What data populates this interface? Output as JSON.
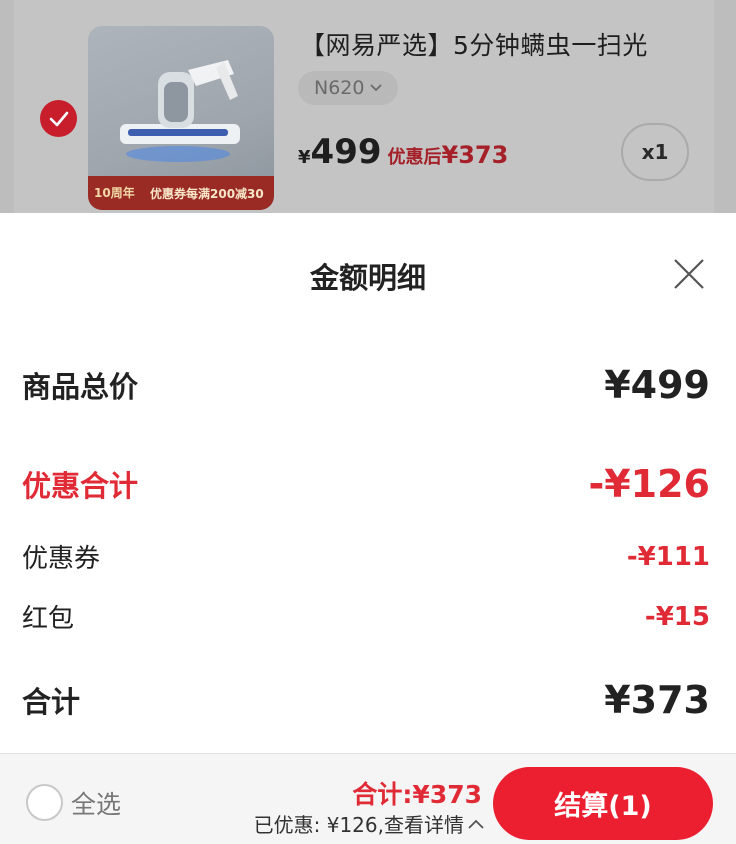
{
  "cart_item": {
    "title": "【网易严选】5分钟螨虫一扫光",
    "sku": "N620",
    "price_symbol": "¥",
    "price": "499",
    "after_discount_label": "优惠后",
    "after_discount_price": "¥373",
    "quantity": "x1",
    "promo_anniversary": "10周年",
    "promo_text": "优惠券每满200减30",
    "checked": true
  },
  "sheet": {
    "title": "金额明细",
    "rows": {
      "subtotal": {
        "label": "商品总价",
        "value": "¥499"
      },
      "discount_total": {
        "label": "优惠合计",
        "value": "-¥126"
      },
      "coupon": {
        "label": "优惠券",
        "value": "-¥111"
      },
      "red_packet": {
        "label": "红包",
        "value": "-¥15"
      },
      "total": {
        "label": "合计",
        "value": "¥373"
      }
    }
  },
  "bottom_bar": {
    "select_all_label": "全选",
    "total_text": "合计:¥373",
    "discount_text": "已优惠: ¥126,查看详情",
    "checkout_label": "结算(1)"
  },
  "colors": {
    "accent_red": "#e02a35",
    "checkout_red": "#ec1f30"
  },
  "icons": {
    "close": "close-icon",
    "check": "check-icon",
    "chevron_down": "chevron-down-icon",
    "chevron_up": "chevron-up-icon"
  }
}
